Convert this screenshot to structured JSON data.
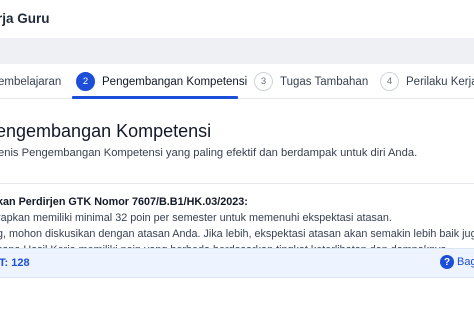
{
  "header": {
    "title": "rja Guru"
  },
  "stepper": {
    "steps": [
      {
        "number": "",
        "label": "embelajaran"
      },
      {
        "number": "2",
        "label": "Pengembangan Kompetensi"
      },
      {
        "number": "3",
        "label": "Tugas Tambahan"
      },
      {
        "number": "4",
        "label": "Perilaku Kerja"
      }
    ],
    "active_index": 1
  },
  "section": {
    "title": "engembangan Kompetensi",
    "description": "enis Pengembangan Kompetensi yang paling efektif dan berdampak untuk diri Anda."
  },
  "rules": {
    "heading": "kan Perdirjen GTK Nomor 7607/B.B1/HK.03/2023:",
    "lines": [
      "rapkan memiliki minimal 32 poin per semester untuk memenuhi ekspektasi atasan.",
      "g, mohon diskusikan dengan atasan Anda. Jika lebih, ekspektasi atasan akan semakin lebih baik juga.",
      "cana Hasil Kerja memiliki poin yang berbeda berdasarkan tingkat keterlibatan dan dampaknya."
    ]
  },
  "footer": {
    "points_text": "IT: 128",
    "help_icon": "question-circle-icon",
    "help_label": "Bag"
  },
  "colors": {
    "accent": "#1d4ed8",
    "footer_bg": "#eef4ff",
    "band_bg": "#eef0f3"
  }
}
